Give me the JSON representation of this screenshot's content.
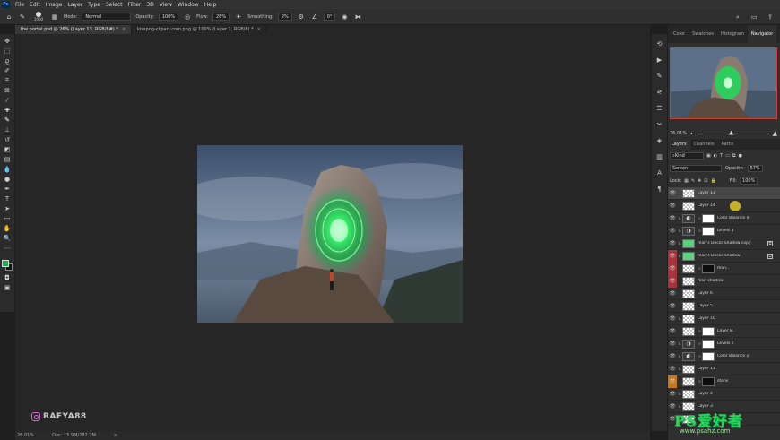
{
  "menu": {
    "logo": "Ps",
    "items": [
      "File",
      "Edit",
      "Image",
      "Layer",
      "Type",
      "Select",
      "Filter",
      "3D",
      "View",
      "Window",
      "Help"
    ]
  },
  "options": {
    "brush_size": "1000",
    "mode_label": "Mode:",
    "mode_value": "Normal",
    "opacity_label": "Opacity:",
    "opacity_value": "100%",
    "flow_label": "Flow:",
    "flow_value": "28%",
    "smoothing_label": "Smoothing:",
    "smoothing_value": "2%",
    "angle_value": "0°"
  },
  "tabs": [
    {
      "label": "the portal.psd @ 26% (Layer 13, RGB/8#) *",
      "close": "×",
      "active": true
    },
    {
      "label": "kisspng-clipart.com.png @ 100% (Layer 1, RGB/8) *",
      "close": "×",
      "active": false
    }
  ],
  "panels": {
    "top_tabs": [
      "Color",
      "Swatches",
      "Histogram",
      "Navigator"
    ],
    "active_top_tab": "Navigator",
    "zoom_value": "26.01%",
    "layer_tabs": [
      "Layers",
      "Channels",
      "Paths"
    ],
    "kind_label": "Kind",
    "blend_mode": "Screen",
    "opacity_label": "Opacity:",
    "opacity_value": "57%",
    "lock_label": "Lock:",
    "fill_label": "Fill:",
    "fill_value": "100%"
  },
  "layers": [
    {
      "name": "Layer 13",
      "thumb": "checker",
      "eye": "normal",
      "selected": true,
      "clipped": false,
      "adj": "",
      "mask": ""
    },
    {
      "name": "Layer 14",
      "thumb": "checker",
      "eye": "normal",
      "selected": false,
      "clipped": false,
      "adj": "",
      "mask": ""
    },
    {
      "name": "Color Balance 4",
      "thumb": "adj",
      "eye": "normal",
      "selected": false,
      "clipped": true,
      "adj": "◐",
      "mask": "white"
    },
    {
      "name": "Levels 3",
      "thumb": "adj",
      "eye": "normal",
      "selected": false,
      "clipped": true,
      "adj": "◑",
      "mask": "white"
    },
    {
      "name": "man's Decor Shadow copy",
      "thumb": "green",
      "eye": "normal",
      "selected": false,
      "clipped": true,
      "adj": "",
      "mask": "",
      "fx": true
    },
    {
      "name": "man's Decor Shadow",
      "thumb": "green",
      "eye": "red",
      "selected": false,
      "clipped": true,
      "adj": "",
      "mask": "",
      "fx": true
    },
    {
      "name": "man..",
      "thumb": "checker",
      "eye": "red",
      "selected": false,
      "clipped": false,
      "adj": "",
      "mask": "black"
    },
    {
      "name": "man shadow",
      "thumb": "checker",
      "eye": "red",
      "selected": false,
      "clipped": false,
      "adj": "",
      "mask": ""
    },
    {
      "name": "Layer 6",
      "thumb": "checker",
      "eye": "normal",
      "selected": false,
      "clipped": false,
      "adj": "",
      "mask": ""
    },
    {
      "name": "Layer 5",
      "thumb": "checker",
      "eye": "normal",
      "selected": false,
      "clipped": false,
      "adj": "",
      "mask": ""
    },
    {
      "name": "Layer 10",
      "thumb": "checker",
      "eye": "normal",
      "selected": false,
      "clipped": true,
      "adj": "",
      "mask": ""
    },
    {
      "name": "Layer 8..",
      "thumb": "checker",
      "eye": "normal",
      "selected": false,
      "clipped": false,
      "adj": "",
      "mask": "white"
    },
    {
      "name": "Levels 2",
      "thumb": "adj",
      "eye": "normal",
      "selected": false,
      "clipped": true,
      "adj": "◑",
      "mask": "white"
    },
    {
      "name": "Color Balance 2",
      "thumb": "adj",
      "eye": "normal",
      "selected": false,
      "clipped": true,
      "adj": "◐",
      "mask": "white"
    },
    {
      "name": "Layer 11",
      "thumb": "checker",
      "eye": "normal",
      "selected": false,
      "clipped": true,
      "adj": "",
      "mask": ""
    },
    {
      "name": "stone",
      "thumb": "checker",
      "eye": "orange",
      "selected": false,
      "clipped": false,
      "adj": "",
      "mask": "black"
    },
    {
      "name": "Layer 4",
      "thumb": "checker",
      "eye": "normal",
      "selected": false,
      "clipped": true,
      "adj": "",
      "mask": ""
    },
    {
      "name": "Layer 3",
      "thumb": "checker",
      "eye": "normal",
      "selected": false,
      "clipped": true,
      "adj": "",
      "mask": ""
    },
    {
      "name": "Layer 2",
      "thumb": "checker",
      "eye": "normal",
      "selected": false,
      "clipped": false,
      "adj": "",
      "mask": ""
    }
  ],
  "status": {
    "zoom": "26.01%",
    "doc": "Doc: 15.9M/282.2M",
    "arrow": ">"
  },
  "watermark": {
    "handle": "RAFYA88"
  },
  "site_badge": {
    "title": "PS爱好者",
    "url": "www.psahz.com"
  },
  "colors": {
    "foreground": "#1ea84e",
    "background": "#111111",
    "portal_glow": "#2bff6a",
    "accent_selected": "#474747"
  }
}
